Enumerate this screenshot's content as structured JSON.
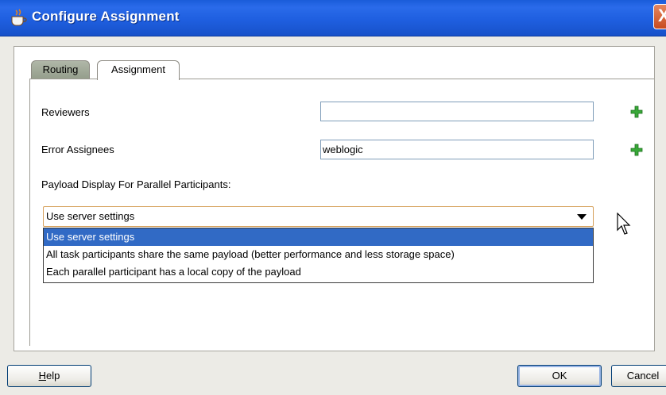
{
  "window": {
    "title": "Configure Assignment",
    "close_glyph": "X",
    "icon": "coffee-cup-icon"
  },
  "tabs": [
    {
      "label": "Routing",
      "active": false
    },
    {
      "label": "Assignment",
      "active": true
    }
  ],
  "form": {
    "reviewers": {
      "label": "Reviewers",
      "value": "",
      "add_icon": "green-plus-icon"
    },
    "error_assignees": {
      "label": "Error Assignees",
      "value": "weblogic",
      "add_icon": "green-plus-icon"
    },
    "payload_display": {
      "label": "Payload Display For Parallel Participants:",
      "selected": "Use server settings",
      "options": [
        "Use server settings",
        "All task participants share the same payload (better performance and less storage space)",
        "Each parallel participant has a local copy of the payload"
      ]
    }
  },
  "buttons": {
    "help": "Help",
    "help_mnemonic": "H",
    "help_rest": "elp",
    "ok": "OK",
    "cancel": "Cancel"
  },
  "colors": {
    "title_bar": "#1f5fe0",
    "selection": "#316ac5",
    "plus": "#2e9a2e"
  }
}
